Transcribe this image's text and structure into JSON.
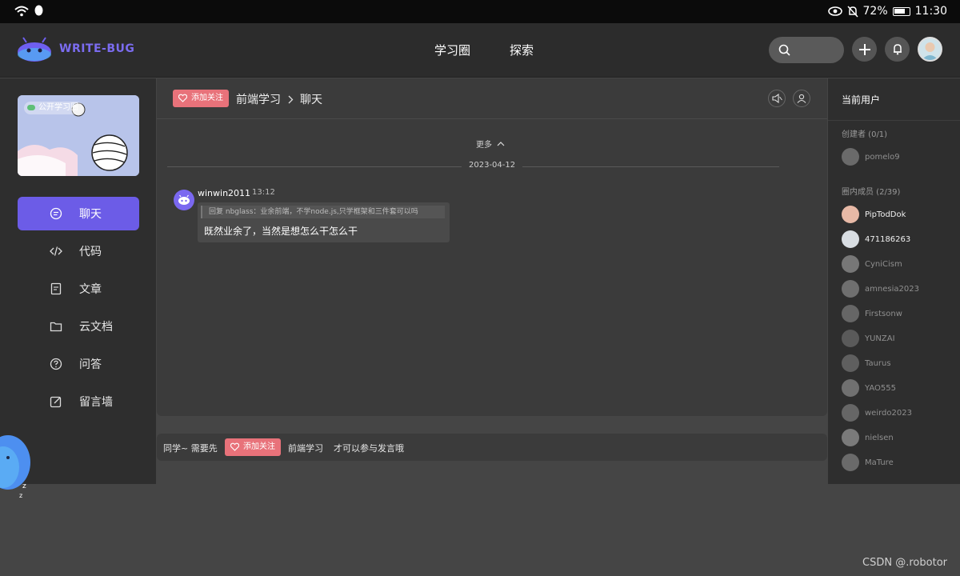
{
  "status_bar": {
    "battery": "72%",
    "time": "11:30"
  },
  "header": {
    "logo_text": "WRITE-BUG",
    "nav": [
      "学习圈",
      "探索"
    ]
  },
  "circle": {
    "cover_tag": "公开学习圈",
    "nav_items": [
      {
        "label": "聊天",
        "icon": "chat-icon",
        "active": true
      },
      {
        "label": "代码",
        "icon": "code-icon",
        "active": false
      },
      {
        "label": "文章",
        "icon": "article-icon",
        "active": false
      },
      {
        "label": "云文档",
        "icon": "folder-icon",
        "active": false
      },
      {
        "label": "问答",
        "icon": "question-icon",
        "active": false
      },
      {
        "label": "留言墙",
        "icon": "edit-icon",
        "active": false
      }
    ]
  },
  "chat": {
    "follow_label": "添加关注",
    "breadcrumb": [
      "前端学习",
      "聊天"
    ],
    "more_label": "更多",
    "date": "2023-04-12",
    "messages": [
      {
        "user": "winwin2011",
        "time": "13:12",
        "quote": "回复 nbglass：业余前端，不学node.js,只学框架和三件套可以吗",
        "text": "既然业余了，当然是想怎么干怎么干"
      }
    ]
  },
  "input_bar": {
    "prefix": "同学~ 需要先",
    "follow_label": "添加关注",
    "circle_name": "前端学习",
    "suffix": "才可以参与发言哦"
  },
  "members": {
    "title": "当前用户",
    "creator_label": "创建者 (0/1)",
    "creator": "pomelo9",
    "members_label": "圈内成员 (2/39)",
    "list": [
      {
        "name": "PipTodDok",
        "online": true
      },
      {
        "name": "471186263",
        "online": true
      },
      {
        "name": "CyniCism",
        "online": false
      },
      {
        "name": "amnesia2023",
        "online": false
      },
      {
        "name": "Firstsonw",
        "online": false
      },
      {
        "name": "YUNZAI",
        "online": false
      },
      {
        "name": "Taurus",
        "online": false
      },
      {
        "name": "YAO555",
        "online": false
      },
      {
        "name": "weirdo2023",
        "online": false
      },
      {
        "name": "nielsen",
        "online": false
      },
      {
        "name": "MaTure",
        "online": false
      }
    ]
  },
  "watermark": "CSDN @.robotor",
  "colors": {
    "accent": "#6c5ce7",
    "follow": "#e8727a"
  }
}
